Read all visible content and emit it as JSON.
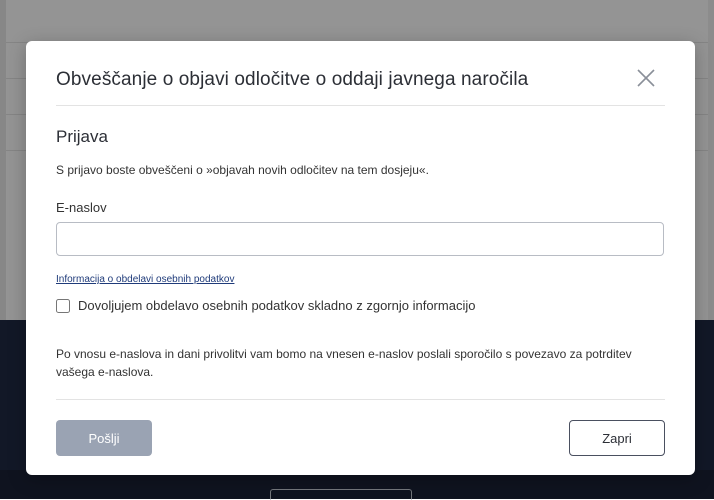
{
  "modal": {
    "title": "Obveščanje o objavi odločitve o oddaji javnega naročila",
    "section_title": "Prijava",
    "description": "S prijavo boste obveščeni o »objavah novih odločitev na tem dosjeju«.",
    "email_label": "E-naslov",
    "email_value": "",
    "email_placeholder": "",
    "info_link": "Informacija o obdelavi osebnih podatkov",
    "consent_label": "Dovoljujem obdelavo osebnih podatkov skladno z zgornjo informacijo",
    "consent_checked": false,
    "note": "Po vnosu e-naslova in dani privolitvi vam bomo na vnesen e-naslov poslali sporočilo s povezavo za potrditev vašega e-naslova.",
    "send_label": "Pošlji",
    "close_label": "Zapri",
    "close_icon": "close-icon"
  },
  "colors": {
    "overlay": "#000000",
    "send_disabled": "#9aa3b3",
    "link": "#1f3b7a",
    "dark_background": "#1f2a44"
  }
}
